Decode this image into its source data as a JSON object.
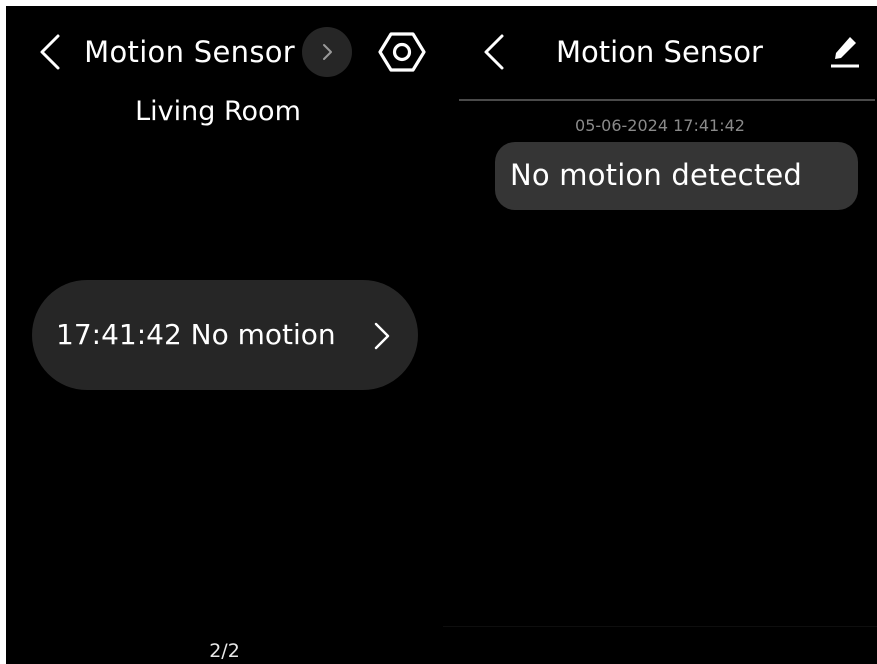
{
  "left_screen": {
    "title": "Motion Sensor",
    "room": "Living Room",
    "event": {
      "label": "17:41:42 No motion"
    },
    "pagination": "2/2",
    "icons": {
      "back": "chevron-left-icon",
      "next": "chevron-right-icon",
      "settings": "hexagon-settings-icon",
      "event_chevron": "chevron-right-icon"
    }
  },
  "right_screen": {
    "title": "Motion Sensor",
    "timestamp": "05-06-2024 17:41:42",
    "message": "No motion detected",
    "icons": {
      "back": "chevron-left-icon",
      "edit": "pencil-icon"
    }
  },
  "colors": {
    "background": "#000000",
    "pill": "#262626",
    "bubble": "#353535",
    "text": "#ffffff",
    "muted_text": "#8a8a8a",
    "divider": "#4a4a4a"
  }
}
